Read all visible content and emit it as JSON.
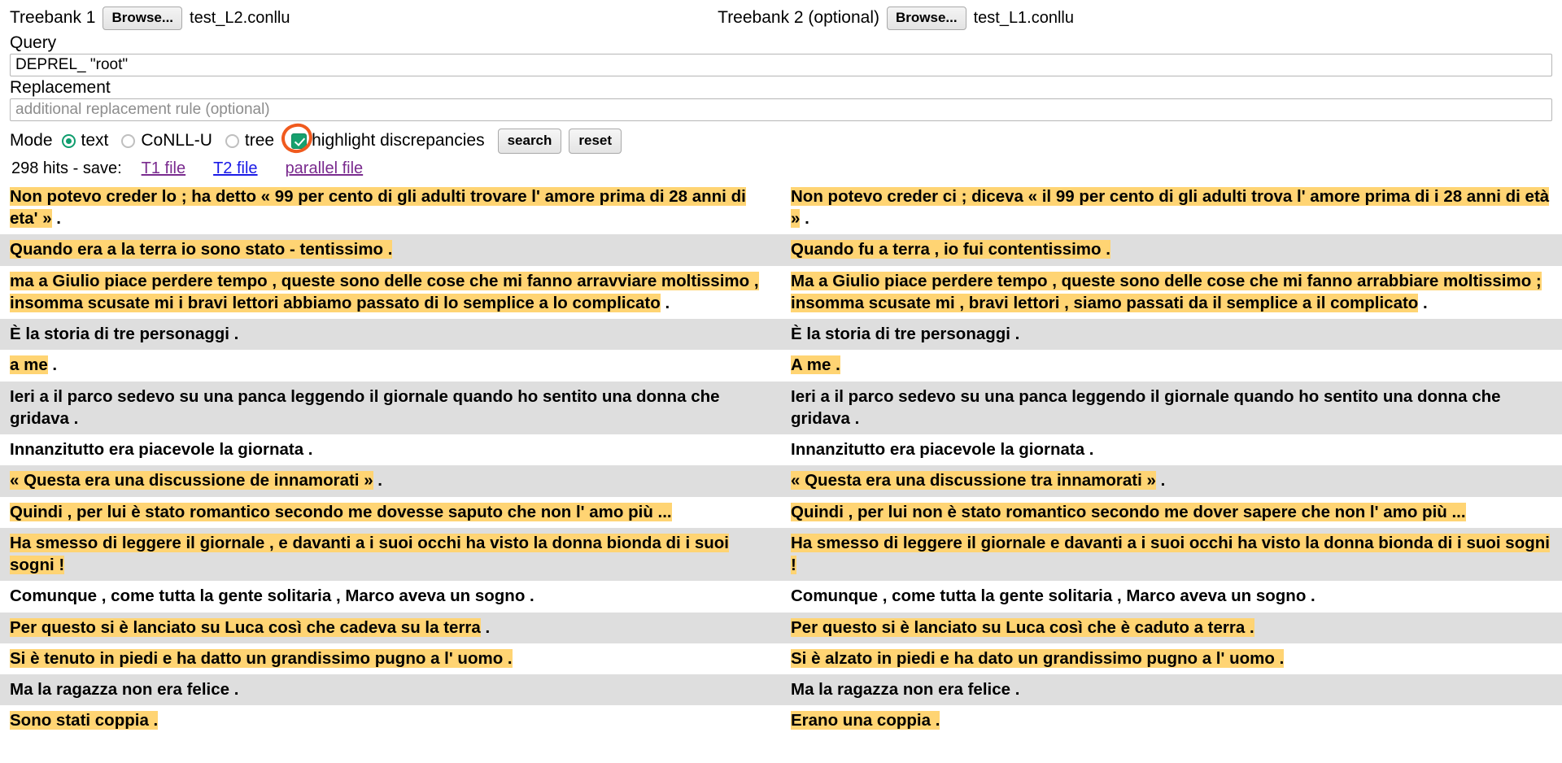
{
  "header": {
    "treebank1_label": "Treebank 1",
    "treebank1_browse": "Browse...",
    "treebank1_file": "test_L2.conllu",
    "treebank2_label": "Treebank 2 (optional)",
    "treebank2_browse": "Browse...",
    "treebank2_file": "test_L1.conllu"
  },
  "query": {
    "label": "Query",
    "value": "DEPREL_ \"root\""
  },
  "replacement": {
    "label": "Replacement",
    "value": "",
    "placeholder": "additional replacement rule (optional)"
  },
  "mode": {
    "label": "Mode",
    "options": [
      {
        "label": "text",
        "selected": true
      },
      {
        "label": "CoNLL-U",
        "selected": false
      },
      {
        "label": "tree",
        "selected": false
      }
    ],
    "highlight_label": "highlight discrepancies",
    "highlight_checked": true,
    "annotation_color": "#f05a1e",
    "accent_color": "#16a06e",
    "search_label": "search",
    "reset_label": "reset"
  },
  "hits": {
    "text": "298 hits - save:",
    "count": 298,
    "links": [
      {
        "label": "T1 file",
        "state": "visited"
      },
      {
        "label": "T2 file",
        "state": "fresh"
      },
      {
        "label": "parallel file",
        "state": "visited"
      }
    ]
  },
  "colors": {
    "highlight": "#ffd473",
    "row_alt": "#dedede",
    "row_base": "#ffffff"
  },
  "results": [
    {
      "t1": [
        {
          "t": "Non potevo creder lo ; ha detto « 99 per cento di gli adulti trovare l' amore prima di 28 anni di eta' »",
          "h": true
        },
        {
          "t": " .",
          "h": false
        }
      ],
      "t2": [
        {
          "t": "Non potevo creder ci ; diceva « il 99 per cento di gli adulti trova l' amore prima di i 28 anni di età »",
          "h": true
        },
        {
          "t": " .",
          "h": false
        }
      ]
    },
    {
      "t1": [
        {
          "t": "Quando era a la terra io sono stato - tentissimo .",
          "h": true
        }
      ],
      "t2": [
        {
          "t": "Quando fu a terra , io fui contentissimo .",
          "h": true
        }
      ]
    },
    {
      "t1": [
        {
          "t": "ma a Giulio piace perdere tempo , queste sono delle cose che mi fanno arravviare moltissimo , insomma scusate mi i bravi lettori abbiamo passato di lo semplice a lo complicato",
          "h": true
        },
        {
          "t": " .",
          "h": false
        }
      ],
      "t2": [
        {
          "t": "Ma a Giulio piace perdere tempo , queste sono delle cose che mi fanno arrabbiare moltissimo ; insomma scusate mi , bravi lettori , siamo passati da il semplice a il complicato",
          "h": true
        },
        {
          "t": " .",
          "h": false
        }
      ]
    },
    {
      "t1": [
        {
          "t": "È la storia di tre personaggi .",
          "h": false
        }
      ],
      "t2": [
        {
          "t": "È la storia di tre personaggi .",
          "h": false
        }
      ]
    },
    {
      "t1": [
        {
          "t": "a me",
          "h": true
        },
        {
          "t": " .",
          "h": false
        }
      ],
      "t2": [
        {
          "t": "A me .",
          "h": true
        }
      ]
    },
    {
      "t1": [
        {
          "t": "Ieri a il parco sedevo su una panca leggendo il giornale quando ho sentito una donna che gridava .",
          "h": false
        }
      ],
      "t2": [
        {
          "t": "Ieri a il parco sedevo su una panca leggendo il giornale quando ho sentito una donna che gridava .",
          "h": false
        }
      ]
    },
    {
      "t1": [
        {
          "t": "Innanzitutto era piacevole la giornata .",
          "h": false
        }
      ],
      "t2": [
        {
          "t": "Innanzitutto era piacevole la giornata .",
          "h": false
        }
      ]
    },
    {
      "t1": [
        {
          "t": "« Questa era una discussione de innamorati »",
          "h": true
        },
        {
          "t": " .",
          "h": false
        }
      ],
      "t2": [
        {
          "t": "« Questa era una discussione tra innamorati »",
          "h": true
        },
        {
          "t": " .",
          "h": false
        }
      ]
    },
    {
      "t1": [
        {
          "t": "Quindi , per lui è stato romantico secondo me dovesse saputo che non l' amo più ...",
          "h": true
        }
      ],
      "t2": [
        {
          "t": "Quindi , per lui non è stato romantico secondo me dover sapere che non l' amo più ...",
          "h": true
        }
      ]
    },
    {
      "t1": [
        {
          "t": "Ha smesso di leggere il giornale , e davanti a i suoi occhi ha visto la donna bionda di i suoi sogni !",
          "h": true
        }
      ],
      "t2": [
        {
          "t": "Ha smesso di leggere il giornale e davanti a i suoi occhi ha visto la donna bionda di i suoi sogni !",
          "h": true
        }
      ]
    },
    {
      "t1": [
        {
          "t": "Comunque , come tutta la gente solitaria , Marco aveva un sogno .",
          "h": false
        }
      ],
      "t2": [
        {
          "t": "Comunque , come tutta la gente solitaria , Marco aveva un sogno .",
          "h": false
        }
      ]
    },
    {
      "t1": [
        {
          "t": "Per questo si è lanciato su Luca così che cadeva su la terra",
          "h": true
        },
        {
          "t": " .",
          "h": false
        }
      ],
      "t2": [
        {
          "t": "Per questo si è lanciato su Luca così che è caduto a terra .",
          "h": true
        }
      ]
    },
    {
      "t1": [
        {
          "t": "Si è tenuto in piedi e ha datto un grandissimo pugno a l' uomo .",
          "h": true
        }
      ],
      "t2": [
        {
          "t": "Si è alzato in piedi e ha dato un grandissimo pugno a l' uomo .",
          "h": true
        }
      ]
    },
    {
      "t1": [
        {
          "t": "Ma la ragazza non era felice .",
          "h": false
        }
      ],
      "t2": [
        {
          "t": "Ma la ragazza non era felice .",
          "h": false
        }
      ]
    },
    {
      "t1": [
        {
          "t": "Sono stati coppia .",
          "h": true
        }
      ],
      "t2": [
        {
          "t": "Erano una coppia .",
          "h": true
        }
      ]
    }
  ]
}
